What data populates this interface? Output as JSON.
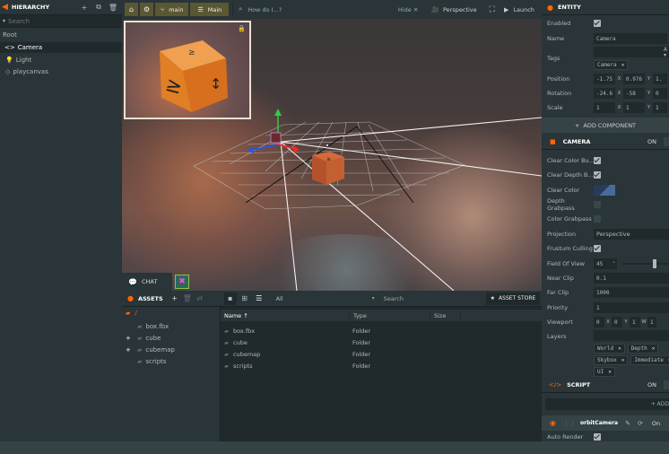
{
  "hierarchy": {
    "title": "HIERARCHY",
    "search_placeholder": "Search",
    "root": "Root",
    "items": [
      {
        "label": "Camera"
      },
      {
        "label": "Light"
      },
      {
        "label": "playcanvas"
      }
    ]
  },
  "toolbar": {
    "branch": "main",
    "scene": "Main",
    "help_placeholder": "How do I...?",
    "hide": "Hide",
    "perspective": "Perspective",
    "launch": "Launch"
  },
  "viewport": {
    "chat": "CHAT"
  },
  "assets": {
    "title": "ASSETS",
    "filter": "All",
    "search_placeholder": "Search",
    "store": "ASSET STORE",
    "tree_root": "/",
    "tree": [
      {
        "label": "box.fbx",
        "expander": ""
      },
      {
        "label": "cube",
        "expander": "+"
      },
      {
        "label": "cubemap",
        "expander": "+"
      },
      {
        "label": "scripts",
        "expander": ""
      }
    ],
    "columns": {
      "name": "Name",
      "type": "Type",
      "size": "Size"
    },
    "rows": [
      {
        "name": "box.fbx",
        "type": "Folder"
      },
      {
        "name": "cube",
        "type": "Folder"
      },
      {
        "name": "cubemap",
        "type": "Folder"
      },
      {
        "name": "scripts",
        "type": "Folder"
      }
    ]
  },
  "entity": {
    "title": "ENTITY",
    "enabled_label": "Enabled",
    "name_label": "Name",
    "name_value": "Camera",
    "tags_label": "Tags",
    "tags": [
      "Camera"
    ],
    "position_label": "Position",
    "position": [
      "-1.75",
      "0.976",
      "1."
    ],
    "rotation_label": "Rotation",
    "rotation": [
      "-24.6",
      "-58",
      "0"
    ],
    "scale_label": "Scale",
    "scale": [
      "1",
      "1",
      "1"
    ],
    "axes": [
      "X",
      "Y",
      "Z"
    ],
    "add_component": "ADD COMPONENT"
  },
  "camera": {
    "title": "CAMERA",
    "toggle": "ON",
    "clear_color_buffer": "Clear Color Bu...",
    "clear_depth_buffer": "Clear Depth B...",
    "clear_color": "Clear Color",
    "depth_grabpass": "Depth Grabpass",
    "color_grabpass": "Color Grabpass",
    "projection_label": "Projection",
    "projection_value": "Perspective",
    "frustum_label": "Frustum Culling",
    "fov_label": "Field Of View",
    "fov_value": "45",
    "fov_fraction": 0.5,
    "near_label": "Near Clip",
    "near_value": "0.1",
    "far_label": "Far Clip",
    "far_value": "1000",
    "priority_label": "Priority",
    "priority_value": "1",
    "viewport_label": "Viewport",
    "viewport_values": [
      "0",
      "0",
      "1",
      "1"
    ],
    "viewport_axes": [
      "X",
      "Y",
      "W"
    ],
    "layers_label": "Layers",
    "layers": [
      "World",
      "Depth",
      "Skybox",
      "Immediate",
      "UI"
    ]
  },
  "script": {
    "title": "SCRIPT",
    "toggle": "ON",
    "add": "+ ADD",
    "orbit_name": "orbitCamera",
    "orbit_toggle": "On",
    "auto_render": "Auto Render"
  },
  "colors": {
    "accent": "#ff6600",
    "panel": "#293538",
    "bg": "#20292b",
    "selected": "#364346"
  }
}
